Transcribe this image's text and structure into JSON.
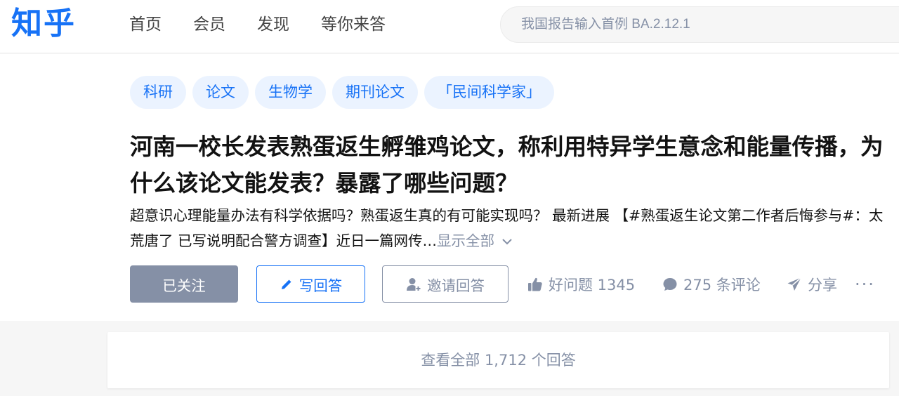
{
  "header": {
    "logo": "知乎",
    "nav": [
      "首页",
      "会员",
      "发现",
      "等你来答"
    ],
    "search_placeholder": "我国报告输入首例 BA.2.12.1"
  },
  "question": {
    "topics": [
      "科研",
      "论文",
      "生物学",
      "期刊论文",
      "「民间科学家」"
    ],
    "title": "河南一校长发表熟蛋返生孵雏鸡论文，称利用特异学生意念和能量传播，为什么该论文能发表？暴露了哪些问题？",
    "excerpt": "超意识心理能量办法有科学依据吗？熟蛋返生真的有可能实现吗？ 最新进展 【#熟蛋返生论文第二作者后悔参与#：太荒唐了 已写说明配合警方调查】近日一篇网传…",
    "show_all": "显示全部"
  },
  "actions": {
    "followed": "已关注",
    "write_answer": "写回答",
    "invite": "邀请回答",
    "good_question": "好问题 1345",
    "comments": "275 条评论",
    "share": "分享",
    "more": "···"
  },
  "view_all": "查看全部 1,712 个回答",
  "colors": {
    "brand": "#1772f6",
    "tag_bg": "#ebf3ff",
    "muted": "#8590a6",
    "page_bg": "#f6f6f6"
  },
  "icons": [
    "pencil-icon",
    "invite-user-icon",
    "thumbs-up-icon",
    "comment-bubble-icon",
    "share-plane-icon",
    "chevron-down-icon"
  ]
}
